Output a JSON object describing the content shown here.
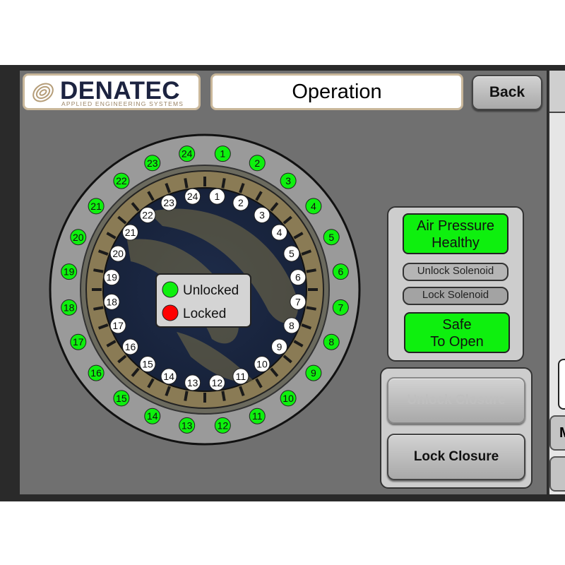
{
  "header": {
    "logo_text": "DENATEC",
    "logo_subtitle": "APPLIED ENGINEERING SYSTEMS",
    "title": "Operation",
    "back_label": "Back"
  },
  "legend": {
    "unlocked_label": "Unlocked",
    "locked_label": "Locked",
    "unlocked_color": "#0ef00e",
    "locked_color": "#ff0000"
  },
  "status": {
    "air_pressure_line1": "Air Pressure",
    "air_pressure_line2": "Healthy",
    "unlock_solenoid": "Unlock Solenoid",
    "lock_solenoid": "Lock Solenoid",
    "safe_line1": "Safe",
    "safe_line2": "To Open",
    "healthy_color": "#0ef00e"
  },
  "controls": {
    "unlock_closure": "Unlock Closure",
    "lock_closure": "Lock Closure"
  },
  "side": {
    "partial_button": "M"
  },
  "outer_sensors": [
    "1",
    "2",
    "3",
    "4",
    "5",
    "6",
    "7",
    "8",
    "9",
    "10",
    "11",
    "12",
    "13",
    "14",
    "15",
    "16",
    "17",
    "18",
    "19",
    "20",
    "21",
    "22",
    "23",
    "24"
  ],
  "inner_pins": [
    "1",
    "2",
    "3",
    "4",
    "5",
    "6",
    "7",
    "8",
    "9",
    "10",
    "11",
    "12",
    "13",
    "14",
    "15",
    "16",
    "17",
    "18",
    "19",
    "20",
    "21",
    "22",
    "23",
    "24"
  ],
  "sensor_state": "unlocked"
}
